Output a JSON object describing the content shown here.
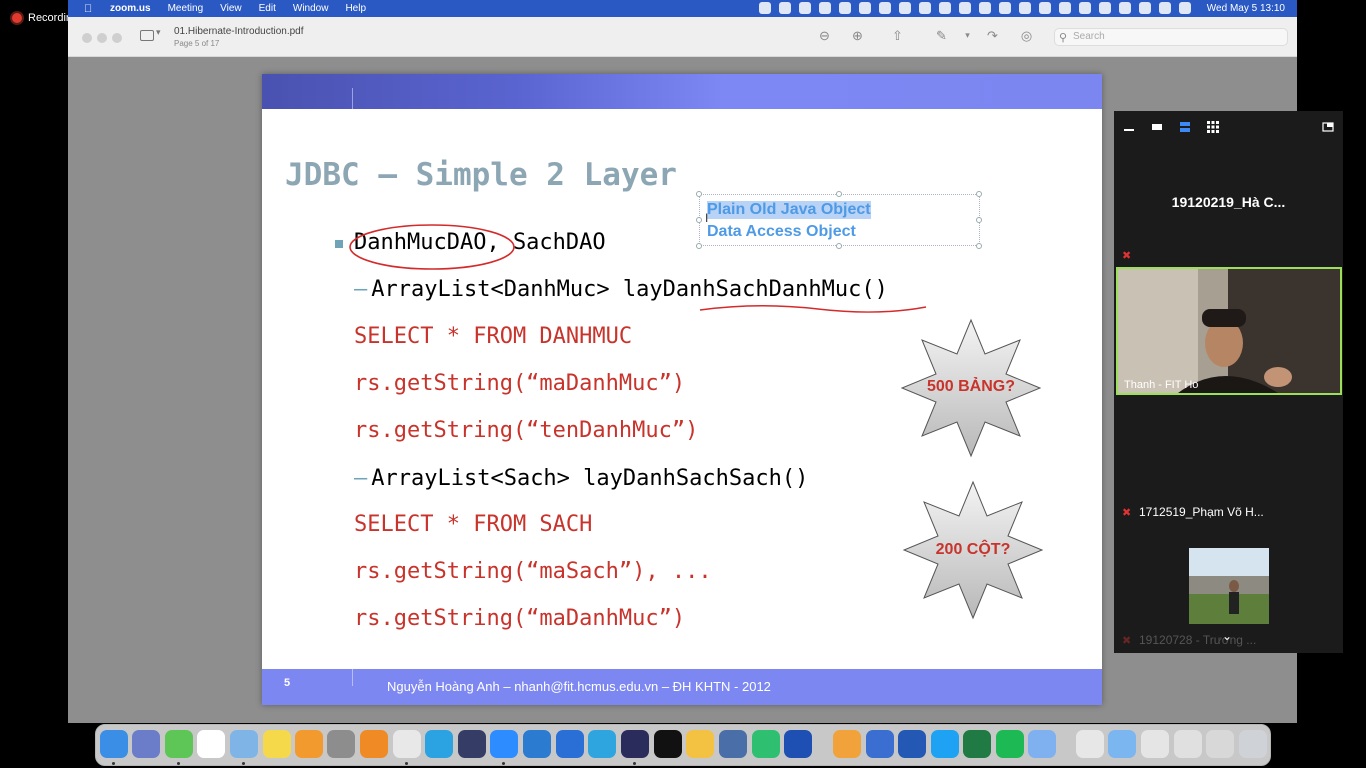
{
  "recording": {
    "label": "Recording"
  },
  "menubar": {
    "app": "zoom.us",
    "items": [
      "Meeting",
      "View",
      "Edit",
      "Window",
      "Help"
    ],
    "clock": "Wed May 5  13:10"
  },
  "preview": {
    "filename": "01.Hibernate-Introduction.pdf",
    "page_info": "Page 5 of 17",
    "search_placeholder": "Search"
  },
  "slide": {
    "title": "JDBC – Simple 2 Layer",
    "bullet_line": "DanhMucDAO, SachDAO",
    "dash1": "ArrayList<DanhMuc> layDanhSachDanhMuc()",
    "red1": "SELECT * FROM DANHMUC",
    "red2": "rs.getString(“maDanhMuc”)",
    "red3": "rs.getString(“tenDanhMuc”)",
    "dash2": "ArrayList<Sach> layDanhSachSach()",
    "red4": "SELECT * FROM SACH",
    "red5": "rs.getString(“maSach”), ...",
    "red6": "rs.getString(“maDanhMuc”)",
    "annotation_line1": "Plain Old Java Object",
    "annotation_line2": "Data Access Object",
    "star1_label": "500 BẢNG?",
    "star2_label": "200 CỘT?",
    "page_number": "5",
    "footer": "Nguyễn Hoàng Anh – nhanh@fit.hcmus.edu.vn – ĐH KHTN - 2012"
  },
  "zoom": {
    "speaker_name": "19120219_Hà C...",
    "video_label": "Thanh - FIT Ho",
    "participant2": "1712519_Phạm Võ H...",
    "participant3": "19120728 - Trương ..."
  }
}
